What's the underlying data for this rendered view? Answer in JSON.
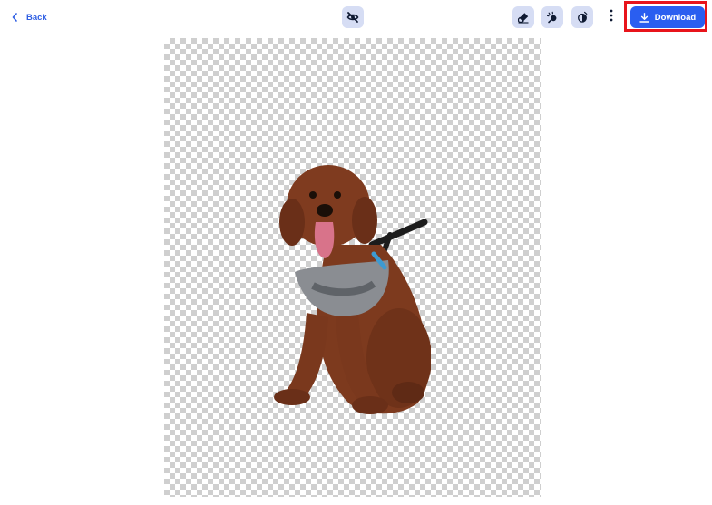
{
  "toolbar": {
    "back_label": "Back",
    "download_label": "Download",
    "icons": {
      "back": "chevron-left-icon",
      "toggle_visibility": "eye-off-icon",
      "erase": "eraser-icon",
      "effects": "magic-wand-icon",
      "shadow": "shadow-icon",
      "more": "more-vertical-icon",
      "download": "download-icon"
    }
  },
  "canvas": {
    "background": "transparent-checkerboard",
    "subject": "dog-cutout"
  },
  "colors": {
    "accent": "#2a5ef0",
    "icon_button_bg": "#d6ddf4",
    "highlight": "#e8141b"
  }
}
